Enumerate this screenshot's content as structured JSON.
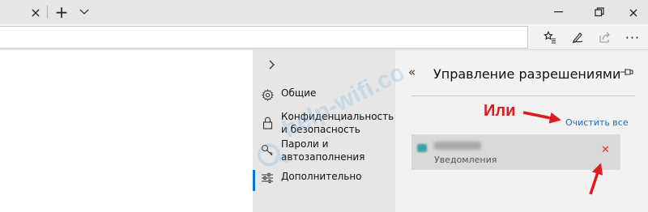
{
  "titlebar": {
    "tab_close_icon": "×",
    "new_tab_icon": "+",
    "tab_list_icon": "chevron-down",
    "window_min_icon": "minimize",
    "window_restore_icon": "restore",
    "window_close_icon": "×"
  },
  "toolbar": {
    "address_value": "",
    "more_icon": "···"
  },
  "settings_nav": {
    "items": [
      {
        "label": "Общие",
        "icon": "gear-icon"
      },
      {
        "label": "Конфиденциальность и безопасность",
        "icon": "lock-icon"
      },
      {
        "label": "Пароли и автозаполнения",
        "icon": "key-icon"
      },
      {
        "label": "Дополнительно",
        "icon": "sliders-icon",
        "active": true
      }
    ]
  },
  "permissions": {
    "back_icon": "«",
    "title": "Управление разрешениями",
    "clear_all": "Очистить все",
    "site": {
      "permission": "Уведомления",
      "remove_icon": "✕"
    }
  },
  "annotation": {
    "text": "Или",
    "color": "#e01b1b"
  },
  "colors": {
    "accent": "#0078d7",
    "link": "#1a6ac2",
    "remove": "#d13438"
  }
}
